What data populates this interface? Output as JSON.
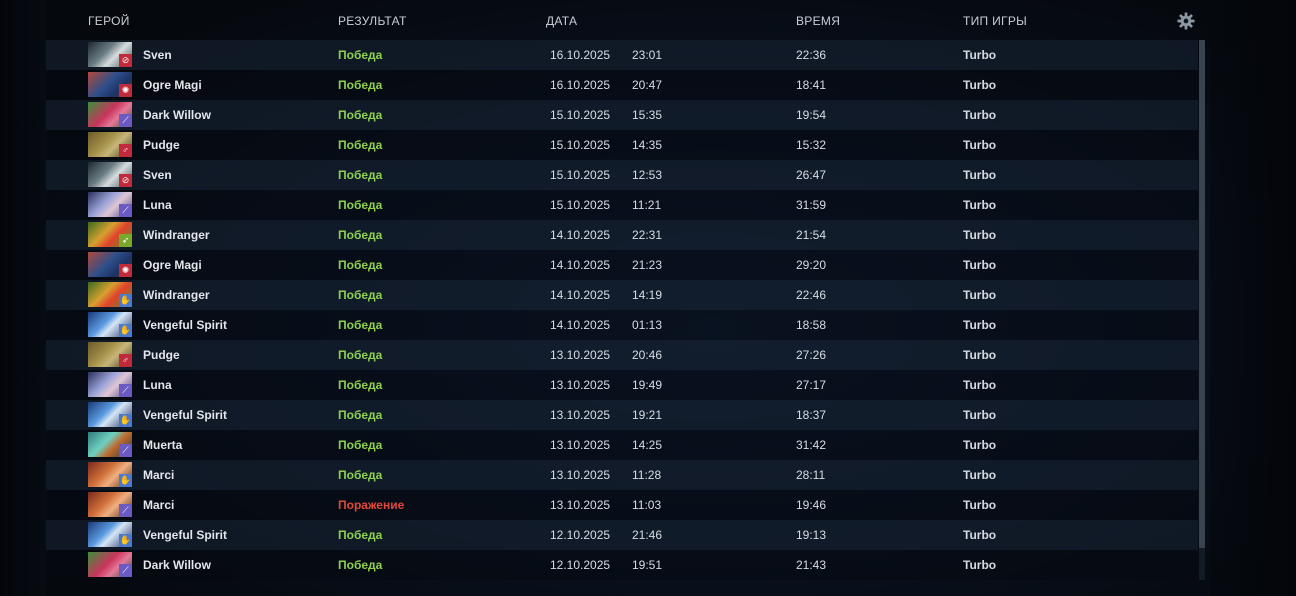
{
  "colors": {
    "win": "#8fd14f",
    "loss": "#e0483c",
    "header_text": "#c9ced6"
  },
  "header": {
    "hero": "Герой",
    "result": "Результат",
    "date": "Дата",
    "duration": "Время",
    "game_type": "Тип игры",
    "settings_icon": "gear-icon"
  },
  "matches": [
    {
      "hero": "Sven",
      "result": "Победа",
      "outcome": "win",
      "date": "16.10.2025",
      "time": "23:01",
      "duration": "22:36",
      "game_type": "Turbo",
      "portrait": "sven",
      "role_icon": "carry-icon"
    },
    {
      "hero": "Ogre Magi",
      "result": "Победа",
      "outcome": "win",
      "date": "16.10.2025",
      "time": "20:47",
      "duration": "18:41",
      "game_type": "Turbo",
      "portrait": "ogre-magi",
      "role_icon": "support-icon"
    },
    {
      "hero": "Dark Willow",
      "result": "Победа",
      "outcome": "win",
      "date": "15.10.2025",
      "time": "15:35",
      "duration": "19:54",
      "game_type": "Turbo",
      "portrait": "dark-willow",
      "role_icon": "sword-icon"
    },
    {
      "hero": "Pudge",
      "result": "Победа",
      "outcome": "win",
      "date": "15.10.2025",
      "time": "14:35",
      "duration": "15:32",
      "game_type": "Turbo",
      "portrait": "pudge",
      "role_icon": "offlane-icon"
    },
    {
      "hero": "Sven",
      "result": "Победа",
      "outcome": "win",
      "date": "15.10.2025",
      "time": "12:53",
      "duration": "26:47",
      "game_type": "Turbo",
      "portrait": "sven",
      "role_icon": "carry-icon"
    },
    {
      "hero": "Luna",
      "result": "Победа",
      "outcome": "win",
      "date": "15.10.2025",
      "time": "11:21",
      "duration": "31:59",
      "game_type": "Turbo",
      "portrait": "luna",
      "role_icon": "sword-icon"
    },
    {
      "hero": "Windranger",
      "result": "Победа",
      "outcome": "win",
      "date": "14.10.2025",
      "time": "22:31",
      "duration": "21:54",
      "game_type": "Turbo",
      "portrait": "windranger",
      "role_icon": "arrow-icon"
    },
    {
      "hero": "Ogre Magi",
      "result": "Победа",
      "outcome": "win",
      "date": "14.10.2025",
      "time": "21:23",
      "duration": "29:20",
      "game_type": "Turbo",
      "portrait": "ogre-magi",
      "role_icon": "support-icon"
    },
    {
      "hero": "Windranger",
      "result": "Победа",
      "outcome": "win",
      "date": "14.10.2025",
      "time": "14:19",
      "duration": "22:46",
      "game_type": "Turbo",
      "portrait": "windranger",
      "role_icon": "hand-icon"
    },
    {
      "hero": "Vengeful Spirit",
      "result": "Победа",
      "outcome": "win",
      "date": "14.10.2025",
      "time": "01:13",
      "duration": "18:58",
      "game_type": "Turbo",
      "portrait": "vengeful-spirit",
      "role_icon": "hand-icon"
    },
    {
      "hero": "Pudge",
      "result": "Победа",
      "outcome": "win",
      "date": "13.10.2025",
      "time": "20:46",
      "duration": "27:26",
      "game_type": "Turbo",
      "portrait": "pudge",
      "role_icon": "offlane-icon"
    },
    {
      "hero": "Luna",
      "result": "Победа",
      "outcome": "win",
      "date": "13.10.2025",
      "time": "19:49",
      "duration": "27:17",
      "game_type": "Turbo",
      "portrait": "luna",
      "role_icon": "sword-icon"
    },
    {
      "hero": "Vengeful Spirit",
      "result": "Победа",
      "outcome": "win",
      "date": "13.10.2025",
      "time": "19:21",
      "duration": "18:37",
      "game_type": "Turbo",
      "portrait": "vengeful-spirit",
      "role_icon": "hand-icon"
    },
    {
      "hero": "Muerta",
      "result": "Победа",
      "outcome": "win",
      "date": "13.10.2025",
      "time": "14:25",
      "duration": "31:42",
      "game_type": "Turbo",
      "portrait": "muerta",
      "role_icon": "knife-icon"
    },
    {
      "hero": "Marci",
      "result": "Победа",
      "outcome": "win",
      "date": "13.10.2025",
      "time": "11:28",
      "duration": "28:11",
      "game_type": "Turbo",
      "portrait": "marci",
      "role_icon": "hand-icon"
    },
    {
      "hero": "Marci",
      "result": "Поражение",
      "outcome": "loss",
      "date": "13.10.2025",
      "time": "11:03",
      "duration": "19:46",
      "game_type": "Turbo",
      "portrait": "marci",
      "role_icon": "knife-icon"
    },
    {
      "hero": "Vengeful Spirit",
      "result": "Победа",
      "outcome": "win",
      "date": "12.10.2025",
      "time": "21:46",
      "duration": "19:13",
      "game_type": "Turbo",
      "portrait": "vengeful-spirit",
      "role_icon": "hand-icon"
    },
    {
      "hero": "Dark Willow",
      "result": "Победа",
      "outcome": "win",
      "date": "12.10.2025",
      "time": "19:51",
      "duration": "21:43",
      "game_type": "Turbo",
      "portrait": "dark-willow",
      "role_icon": "sword-icon"
    }
  ]
}
